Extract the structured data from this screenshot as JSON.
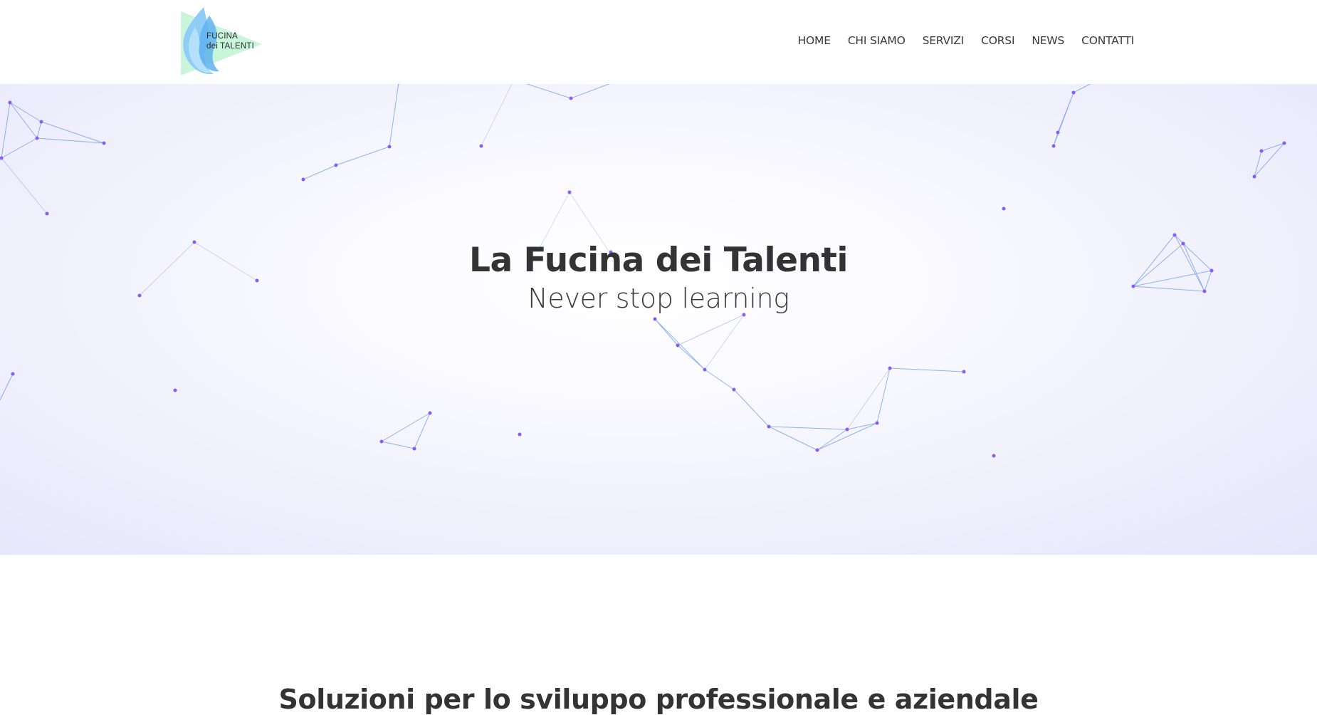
{
  "header": {
    "logo": {
      "line1": "FUCINA",
      "line2": "dei TALENTI",
      "icon": "flame-logo-icon",
      "colors": {
        "flame": "#7ec4f5",
        "flame_dark": "#3fa0e8",
        "pennant": "#c8f5d8"
      }
    },
    "nav": [
      {
        "label": "HOME"
      },
      {
        "label": "CHI SIAMO"
      },
      {
        "label": "SERVIZI"
      },
      {
        "label": "CORSI"
      },
      {
        "label": "NEWS"
      },
      {
        "label": "CONTATTI"
      }
    ]
  },
  "hero": {
    "title": "La Fucina dei Talenti",
    "subtitle": "Never stop learning",
    "background": "particle-network",
    "colors": {
      "node": "#8a5cf0",
      "line": "#6c9be8"
    }
  },
  "section": {
    "heading": "Soluzioni per lo sviluppo professionale e aziendale"
  }
}
